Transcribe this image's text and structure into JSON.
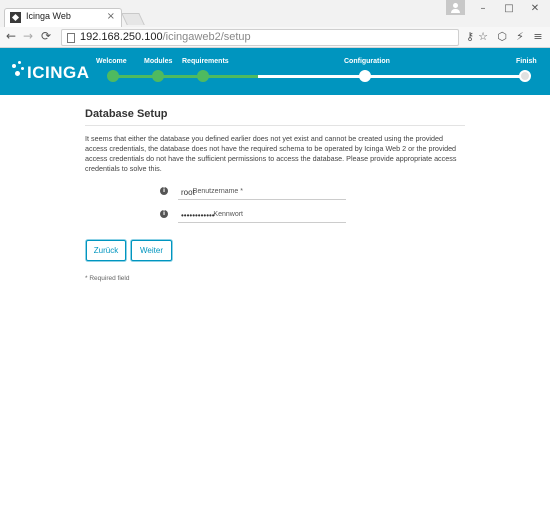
{
  "browser": {
    "tab_title": "Icinga Web",
    "tab_close": "×",
    "window_controls": [
      "–",
      "□",
      "✕"
    ],
    "nav": {
      "back": "←",
      "forward": "→",
      "reload": "⟳"
    },
    "url_host": "192.168.250.100",
    "url_path": "/icingaweb2/setup",
    "toolbar_icons": [
      "key-icon",
      "star-icon",
      "shield-icon",
      "slash-icon",
      "menu-icon"
    ],
    "toolbar_glyphs": [
      "⚷",
      "☆",
      "⬡",
      "⚡",
      "≡"
    ]
  },
  "header": {
    "logo_text": "ICINGA",
    "steps": [
      {
        "label": "Welcome",
        "status": "done"
      },
      {
        "label": "Modules",
        "status": "done"
      },
      {
        "label": "Requirements",
        "status": "done"
      },
      {
        "label": "Configuration",
        "status": "current"
      },
      {
        "label": "Finish",
        "status": "pending"
      }
    ],
    "colors": {
      "bar": "#0095bf",
      "done": "#4fba5f",
      "todo": "#ffffff"
    }
  },
  "main": {
    "title": "Database Setup",
    "description": "It seems that either the database you defined earlier does not yet exist and cannot be created using the provided access credentials, the database does not have the required schema to be operated by Icinga Web 2 or the provided access credentials do not have the sufficient permissions to access the database. Please provide appropriate access credentials to solve this.",
    "fields": {
      "username_label": "Benutzername *",
      "username_value": "root",
      "password_label": "Kennwort",
      "password_value": "••••••••••••",
      "info_glyph": "i"
    },
    "buttons": {
      "back": "Zurück",
      "next": "Weiter"
    },
    "required_note": "* Required field"
  }
}
